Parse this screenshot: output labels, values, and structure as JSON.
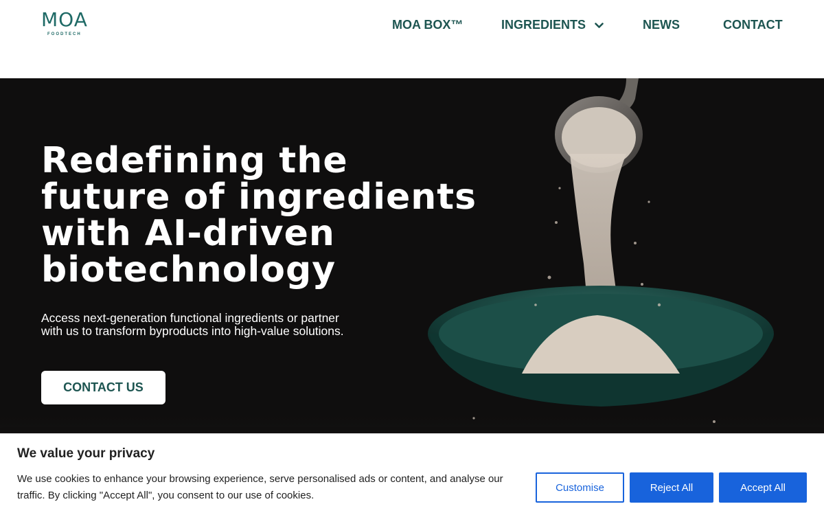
{
  "brand": {
    "logo_main": "MOA",
    "logo_sub": "FOODTECH",
    "color": "#1f6a66"
  },
  "nav": {
    "items": [
      {
        "label": "MOA BOX™"
      },
      {
        "label": "INGREDIENTS",
        "icon": "chevron-down-icon"
      },
      {
        "label": "NEWS"
      },
      {
        "label": "CONTACT"
      }
    ]
  },
  "hero": {
    "title_lines": [
      "Redefining the",
      "future of ingredients",
      "with AI-driven",
      "biotechnology"
    ],
    "subtitle_lines": [
      "Access next-generation functional ingredients or partner",
      "with us  to transform byproducts into high-value solutions."
    ],
    "cta_label": "CONTACT US"
  },
  "cookie_banner": {
    "title": "We value your privacy",
    "text_lines": [
      "We use cookies to enhance your browsing experience, serve personalised ads or content, and analyse our",
      "traffic. By clicking \"Accept All\", you consent to our use of cookies."
    ],
    "customise_label": "Customise",
    "reject_label": "Reject All",
    "accept_label": "Accept All",
    "accent": "#1863dc"
  }
}
